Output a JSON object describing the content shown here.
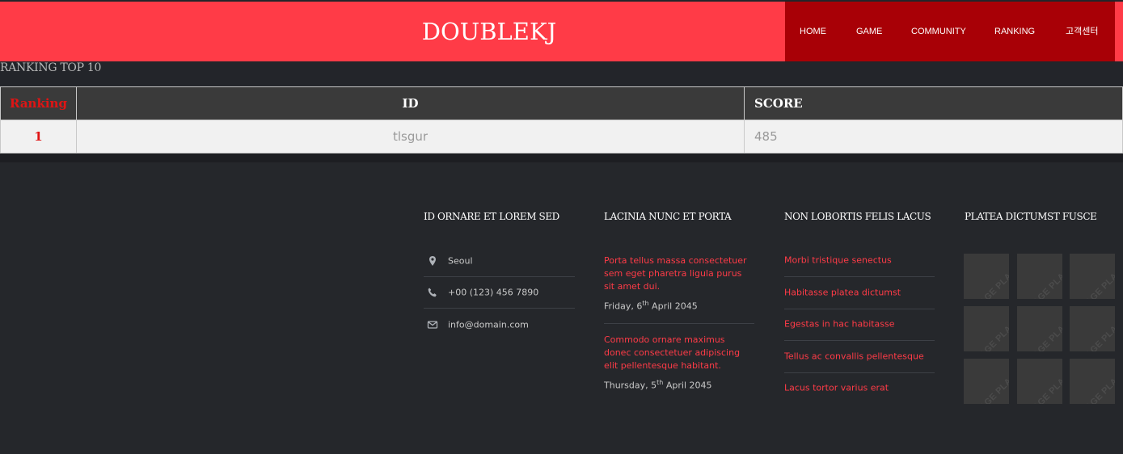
{
  "header": {
    "brand": "DOUBLEKJ",
    "nav": [
      "HOME",
      "GAME",
      "COMMUNITY",
      "RANKING",
      "고객센터"
    ]
  },
  "ranking": {
    "title": "RANKING TOP 10",
    "columns": [
      "Ranking",
      "ID",
      "SCORE"
    ],
    "rows": [
      {
        "rank": "1",
        "id": "tlsgur",
        "score": "485"
      }
    ]
  },
  "footer": {
    "col1": {
      "title": "ID ORNARE ET LOREM SED",
      "items": [
        {
          "icon": "map-marker-icon",
          "text": "Seoul"
        },
        {
          "icon": "phone-icon",
          "text": "+00 (123) 456 7890"
        },
        {
          "icon": "envelope-icon",
          "text": "info@domain.com"
        }
      ]
    },
    "col2": {
      "title": "LACINIA NUNC ET PORTA",
      "posts": [
        {
          "text": "Porta tellus massa consectetuer sem eget pharetra ligula purus sit amet dui.",
          "day": "Friday, 6",
          "suffix": "th",
          "rest": " April 2045"
        },
        {
          "text": "Commodo ornare maximus donec consectetuer adipiscing elit pellentesque habitant.",
          "day": "Thursday, 5",
          "suffix": "th",
          "rest": " April 2045"
        }
      ]
    },
    "col3": {
      "title": "NON LOBORTIS FELIS LACUS",
      "links": [
        "Morbi tristique senectus",
        "Habitasse platea dictumst",
        "Egestas in hac habitasse",
        "Tellus ac convallis pellentesque",
        "Lacus tortor varius erat"
      ]
    },
    "col4": {
      "title": "PLATEA DICTUMST FUSCE",
      "thumb_label": "IMAGE PLACEHOLDER"
    }
  },
  "colors": {
    "brand_red": "#ff3b47",
    "nav_dark_red": "#a80006",
    "footer_bg": "#25272b"
  }
}
